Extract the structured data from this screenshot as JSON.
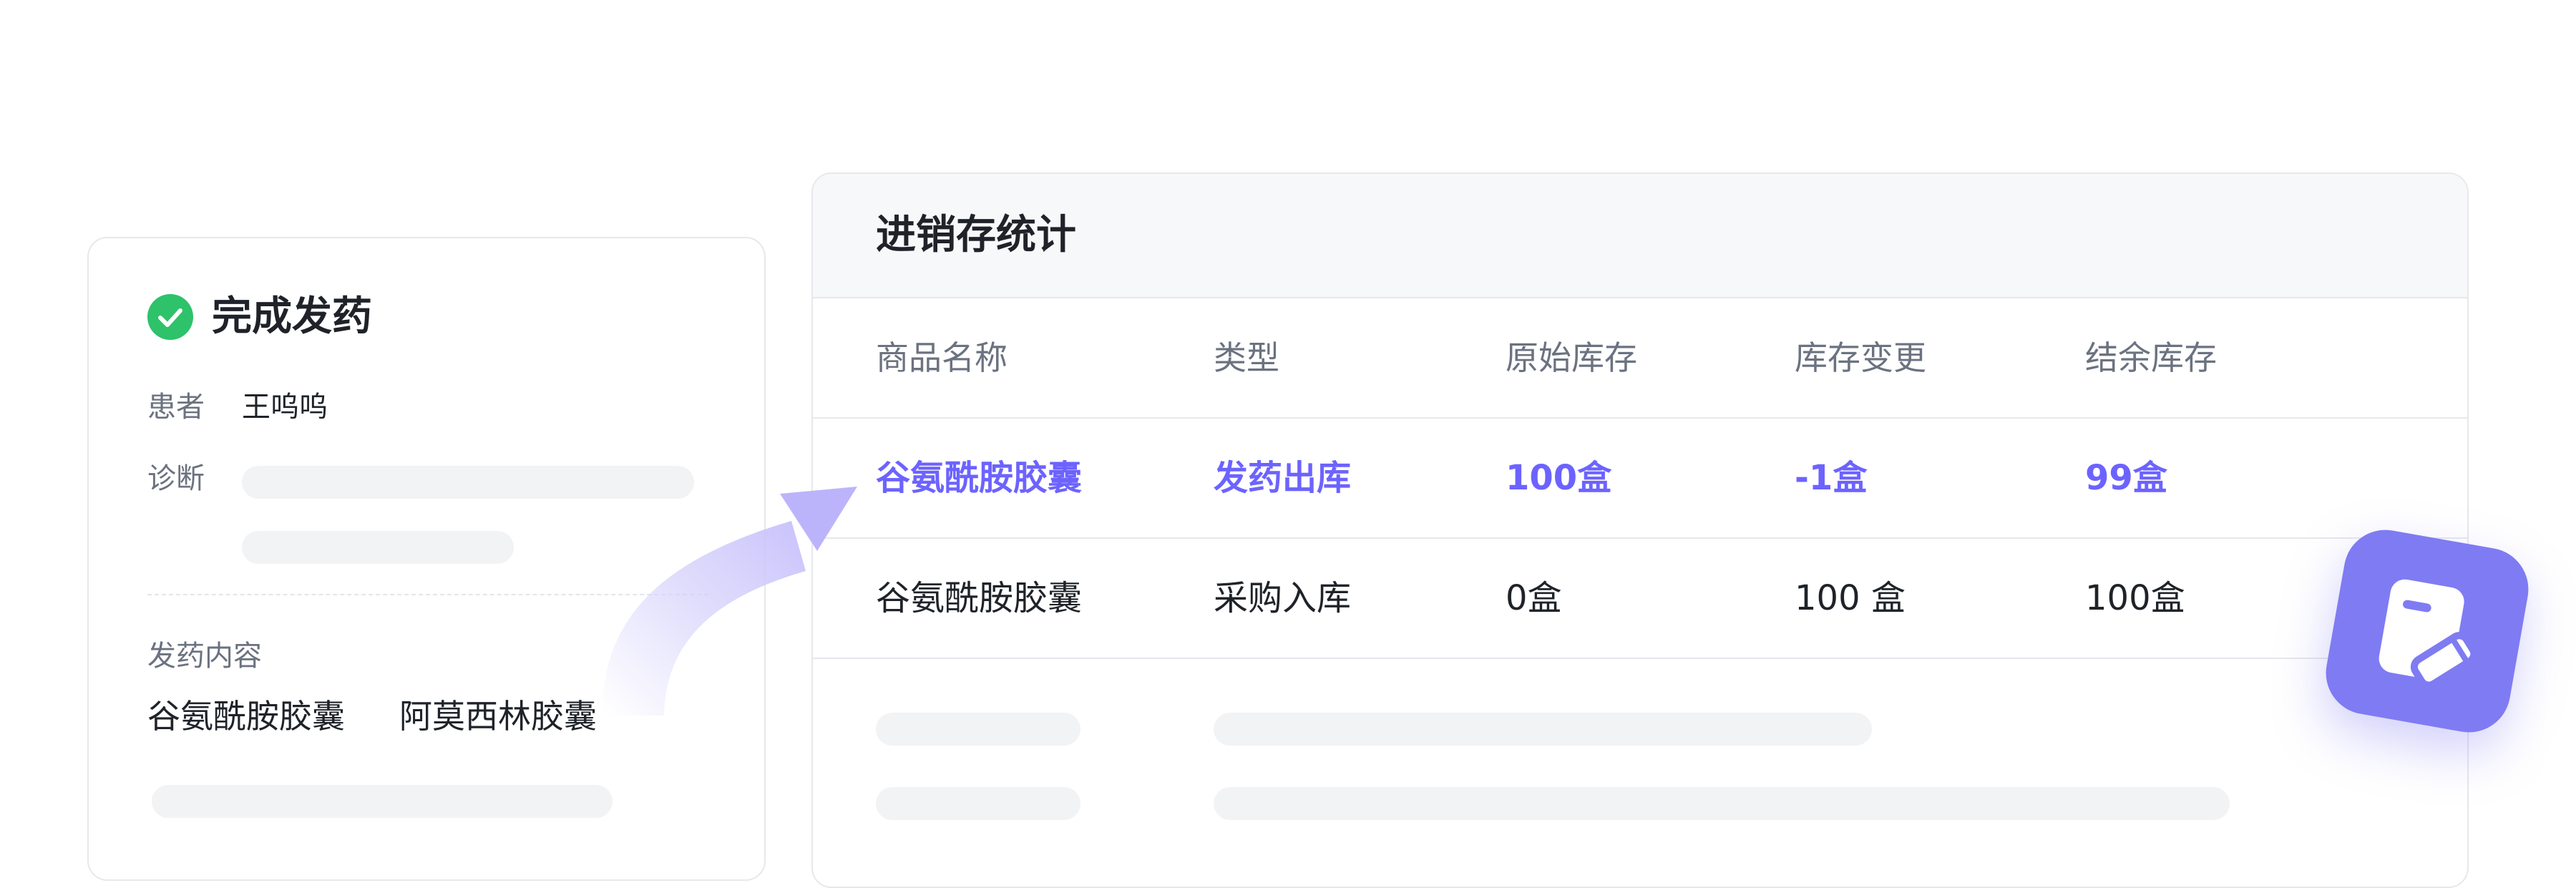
{
  "dispense_card": {
    "title": "完成发药",
    "patient_label": "患者",
    "patient_name": "王呜呜",
    "diagnosis_label": "诊断",
    "content_label": "发药内容",
    "medications": [
      "谷氨酰胺胶囊",
      "阿莫西林胶囊"
    ],
    "status_color": "#2ec26a"
  },
  "inventory": {
    "title": "进销存统计",
    "columns": [
      "商品名称",
      "类型",
      "原始库存",
      "库存变更",
      "结余库存"
    ],
    "rows": [
      {
        "name": "谷氨酰胺胶囊",
        "type": "发药出库",
        "original": "100盒",
        "change": "-1盒",
        "balance": "99盒",
        "highlighted": true
      },
      {
        "name": "谷氨酰胺胶囊",
        "type": "采购入库",
        "original": "0盒",
        "change": "100 盒",
        "balance": "100盒",
        "highlighted": false
      }
    ],
    "highlight_color": "#6c63ff"
  },
  "icons": {
    "status": "check-circle-icon",
    "arrow": "curved-arrow-icon",
    "badge": "edit-document-icon"
  }
}
